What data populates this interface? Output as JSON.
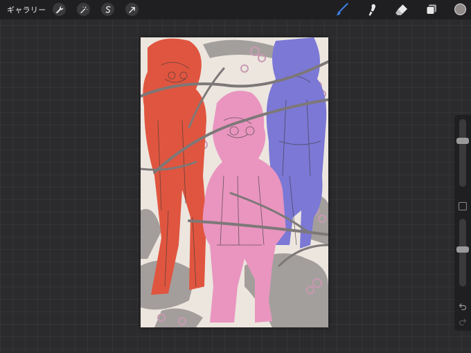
{
  "topbar": {
    "gallery_label": "ギャラリー",
    "left_tools": [
      "wrench-icon",
      "magic-wand-icon",
      "selection-icon",
      "transform-arrow-icon"
    ],
    "right_tools": [
      "brush-icon",
      "smudge-icon",
      "eraser-icon",
      "layers-icon"
    ],
    "current_color": "#8f8a88",
    "active_tool_color": "#3b7bdc"
  },
  "sidebar": {
    "brush_size_level": 0.3,
    "opacity_level": 0.45
  },
  "artwork": {
    "figure_colors": [
      "#e0553f",
      "#e995bf",
      "#7b78d6"
    ]
  }
}
